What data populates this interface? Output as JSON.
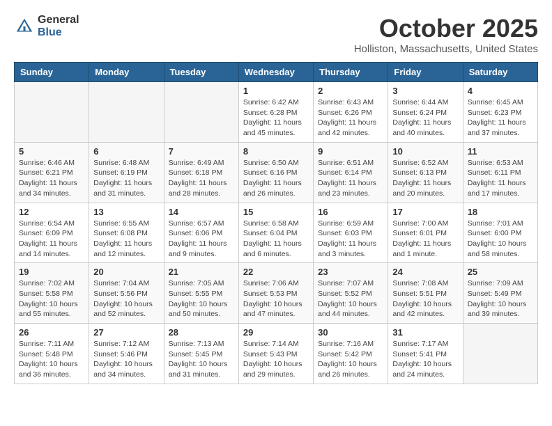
{
  "header": {
    "logo_general": "General",
    "logo_blue": "Blue",
    "month_title": "October 2025",
    "location": "Holliston, Massachusetts, United States"
  },
  "days_of_week": [
    "Sunday",
    "Monday",
    "Tuesday",
    "Wednesday",
    "Thursday",
    "Friday",
    "Saturday"
  ],
  "weeks": [
    [
      {
        "day": "",
        "info": ""
      },
      {
        "day": "",
        "info": ""
      },
      {
        "day": "",
        "info": ""
      },
      {
        "day": "1",
        "info": "Sunrise: 6:42 AM\nSunset: 6:28 PM\nDaylight: 11 hours\nand 45 minutes."
      },
      {
        "day": "2",
        "info": "Sunrise: 6:43 AM\nSunset: 6:26 PM\nDaylight: 11 hours\nand 42 minutes."
      },
      {
        "day": "3",
        "info": "Sunrise: 6:44 AM\nSunset: 6:24 PM\nDaylight: 11 hours\nand 40 minutes."
      },
      {
        "day": "4",
        "info": "Sunrise: 6:45 AM\nSunset: 6:23 PM\nDaylight: 11 hours\nand 37 minutes."
      }
    ],
    [
      {
        "day": "5",
        "info": "Sunrise: 6:46 AM\nSunset: 6:21 PM\nDaylight: 11 hours\nand 34 minutes."
      },
      {
        "day": "6",
        "info": "Sunrise: 6:48 AM\nSunset: 6:19 PM\nDaylight: 11 hours\nand 31 minutes."
      },
      {
        "day": "7",
        "info": "Sunrise: 6:49 AM\nSunset: 6:18 PM\nDaylight: 11 hours\nand 28 minutes."
      },
      {
        "day": "8",
        "info": "Sunrise: 6:50 AM\nSunset: 6:16 PM\nDaylight: 11 hours\nand 26 minutes."
      },
      {
        "day": "9",
        "info": "Sunrise: 6:51 AM\nSunset: 6:14 PM\nDaylight: 11 hours\nand 23 minutes."
      },
      {
        "day": "10",
        "info": "Sunrise: 6:52 AM\nSunset: 6:13 PM\nDaylight: 11 hours\nand 20 minutes."
      },
      {
        "day": "11",
        "info": "Sunrise: 6:53 AM\nSunset: 6:11 PM\nDaylight: 11 hours\nand 17 minutes."
      }
    ],
    [
      {
        "day": "12",
        "info": "Sunrise: 6:54 AM\nSunset: 6:09 PM\nDaylight: 11 hours\nand 14 minutes."
      },
      {
        "day": "13",
        "info": "Sunrise: 6:55 AM\nSunset: 6:08 PM\nDaylight: 11 hours\nand 12 minutes."
      },
      {
        "day": "14",
        "info": "Sunrise: 6:57 AM\nSunset: 6:06 PM\nDaylight: 11 hours\nand 9 minutes."
      },
      {
        "day": "15",
        "info": "Sunrise: 6:58 AM\nSunset: 6:04 PM\nDaylight: 11 hours\nand 6 minutes."
      },
      {
        "day": "16",
        "info": "Sunrise: 6:59 AM\nSunset: 6:03 PM\nDaylight: 11 hours\nand 3 minutes."
      },
      {
        "day": "17",
        "info": "Sunrise: 7:00 AM\nSunset: 6:01 PM\nDaylight: 11 hours\nand 1 minute."
      },
      {
        "day": "18",
        "info": "Sunrise: 7:01 AM\nSunset: 6:00 PM\nDaylight: 10 hours\nand 58 minutes."
      }
    ],
    [
      {
        "day": "19",
        "info": "Sunrise: 7:02 AM\nSunset: 5:58 PM\nDaylight: 10 hours\nand 55 minutes."
      },
      {
        "day": "20",
        "info": "Sunrise: 7:04 AM\nSunset: 5:56 PM\nDaylight: 10 hours\nand 52 minutes."
      },
      {
        "day": "21",
        "info": "Sunrise: 7:05 AM\nSunset: 5:55 PM\nDaylight: 10 hours\nand 50 minutes."
      },
      {
        "day": "22",
        "info": "Sunrise: 7:06 AM\nSunset: 5:53 PM\nDaylight: 10 hours\nand 47 minutes."
      },
      {
        "day": "23",
        "info": "Sunrise: 7:07 AM\nSunset: 5:52 PM\nDaylight: 10 hours\nand 44 minutes."
      },
      {
        "day": "24",
        "info": "Sunrise: 7:08 AM\nSunset: 5:51 PM\nDaylight: 10 hours\nand 42 minutes."
      },
      {
        "day": "25",
        "info": "Sunrise: 7:09 AM\nSunset: 5:49 PM\nDaylight: 10 hours\nand 39 minutes."
      }
    ],
    [
      {
        "day": "26",
        "info": "Sunrise: 7:11 AM\nSunset: 5:48 PM\nDaylight: 10 hours\nand 36 minutes."
      },
      {
        "day": "27",
        "info": "Sunrise: 7:12 AM\nSunset: 5:46 PM\nDaylight: 10 hours\nand 34 minutes."
      },
      {
        "day": "28",
        "info": "Sunrise: 7:13 AM\nSunset: 5:45 PM\nDaylight: 10 hours\nand 31 minutes."
      },
      {
        "day": "29",
        "info": "Sunrise: 7:14 AM\nSunset: 5:43 PM\nDaylight: 10 hours\nand 29 minutes."
      },
      {
        "day": "30",
        "info": "Sunrise: 7:16 AM\nSunset: 5:42 PM\nDaylight: 10 hours\nand 26 minutes."
      },
      {
        "day": "31",
        "info": "Sunrise: 7:17 AM\nSunset: 5:41 PM\nDaylight: 10 hours\nand 24 minutes."
      },
      {
        "day": "",
        "info": ""
      }
    ]
  ]
}
